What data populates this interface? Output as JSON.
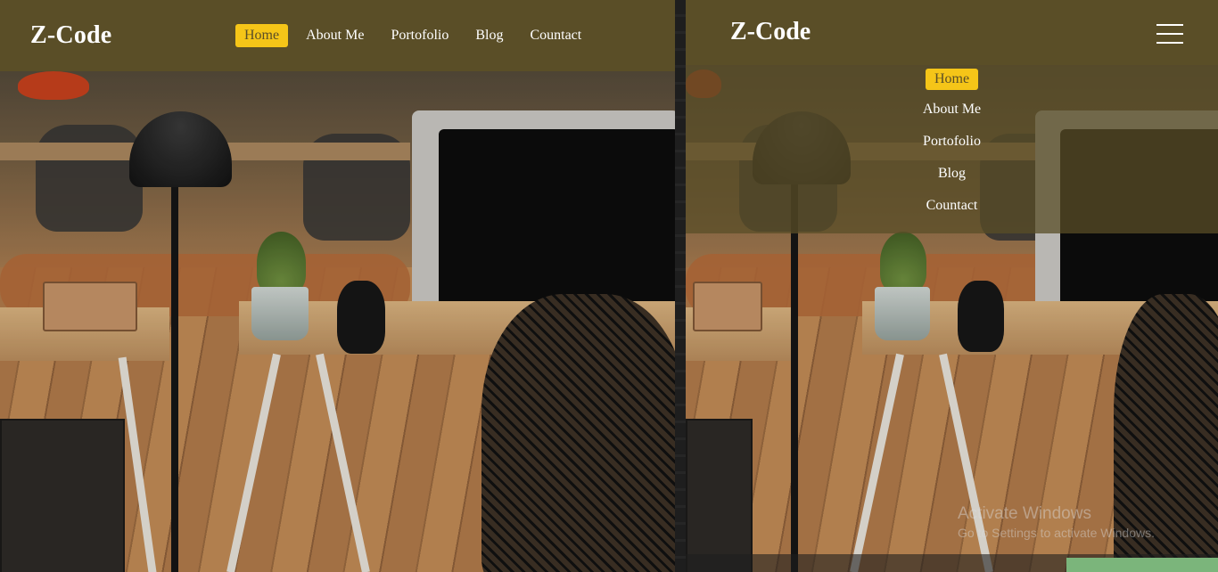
{
  "site": {
    "brand": "Z-Code",
    "menu": [
      {
        "label": "Home",
        "active": true
      },
      {
        "label": "About Me",
        "active": false
      },
      {
        "label": "Portofolio",
        "active": false
      },
      {
        "label": "Blog",
        "active": false
      },
      {
        "label": "Countact",
        "active": false
      }
    ]
  },
  "mobile": {
    "brand": "Z-Code",
    "menu": [
      {
        "label": "Home",
        "active": true
      },
      {
        "label": "About Me",
        "active": false
      },
      {
        "label": "Portofolio",
        "active": false
      },
      {
        "label": "Blog",
        "active": false
      },
      {
        "label": "Countact",
        "active": false
      }
    ],
    "hamburger_icon": "hamburger-menu-icon"
  },
  "watermark": {
    "title": "Activate Windows",
    "subtitle": "Go to Settings to activate Windows."
  },
  "colors": {
    "navbar": "#5a4e27",
    "active_item": "#f5c518",
    "text": "#ffffff"
  }
}
